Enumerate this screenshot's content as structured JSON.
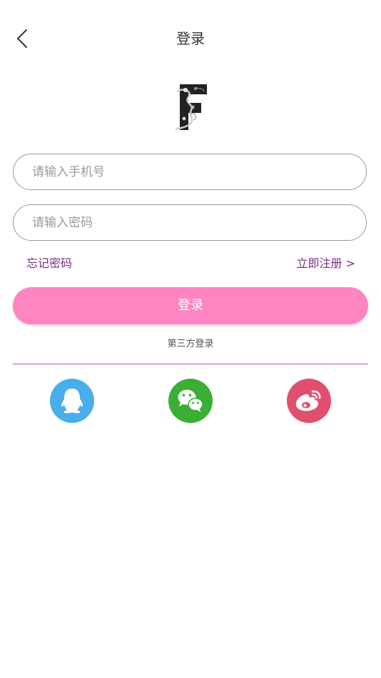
{
  "header": {
    "title": "登录",
    "back_icon": "chevron-left-icon"
  },
  "logo": {
    "icon": "brand-logo-f"
  },
  "form": {
    "phone": {
      "placeholder": "请输入手机号",
      "value": ""
    },
    "password": {
      "placeholder": "请输入密码",
      "value": ""
    },
    "forgot_label": "忘记密码",
    "register_label": "立即注册 >",
    "login_label": "登录"
  },
  "third_party": {
    "label": "第三方登录",
    "providers": [
      {
        "name": "QQ",
        "icon": "qq-icon",
        "color": "#4aaeea"
      },
      {
        "name": "WeChat",
        "icon": "wechat-icon",
        "color": "#3aae35"
      },
      {
        "name": "Weibo",
        "icon": "weibo-icon",
        "color": "#e0506e"
      }
    ]
  },
  "colors": {
    "accent": "#ff85c2",
    "link": "#7a2e82",
    "divider": "#b05aa8",
    "border": "#9a9a9a"
  }
}
